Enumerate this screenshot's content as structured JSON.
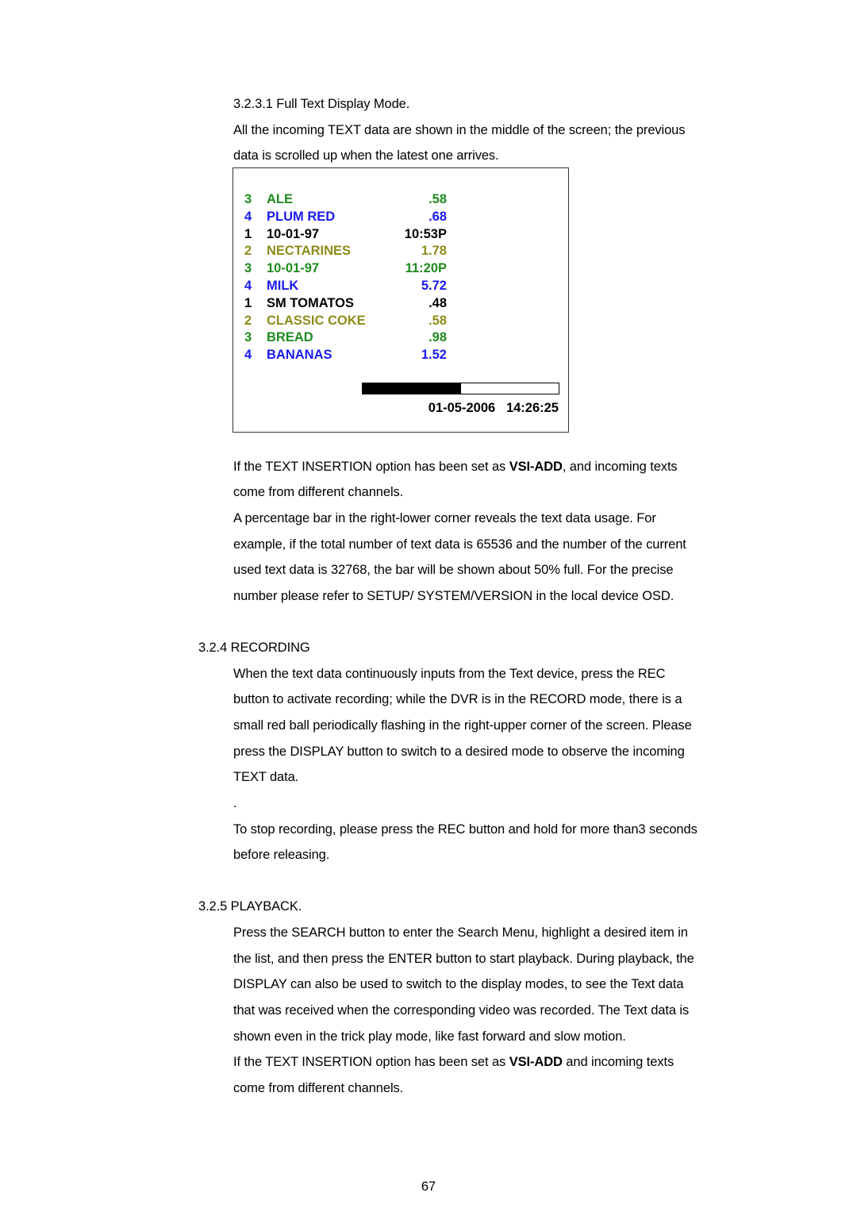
{
  "section_heading": "3.2.3.1 Full Text Display Mode.",
  "intro_lines": [
    "All the incoming TEXT data are shown in the middle of the screen; the previous",
    "data is scrolled up when the latest one arrives."
  ],
  "osd": {
    "rows": [
      {
        "channel": "3",
        "name": "ALE",
        "value": ".58",
        "color": "#1e8c1e"
      },
      {
        "channel": "4",
        "name": "PLUM RED",
        "value": ".68",
        "color": "#1a1aee"
      },
      {
        "channel": "1",
        "name": "10-01-97",
        "value": "10:53P",
        "color": "#000000"
      },
      {
        "channel": "2",
        "name": "NECTARINES",
        "value": "1.78",
        "color": "#8c8c1a"
      },
      {
        "channel": "3",
        "name": "10-01-97",
        "value": "11:20P",
        "color": "#1e8c1e"
      },
      {
        "channel": "4",
        "name": "MILK",
        "value": "5.72",
        "color": "#1a1aee"
      },
      {
        "channel": "1",
        "name": "SM TOMATOS",
        "value": ".48",
        "color": "#000000"
      },
      {
        "channel": "2",
        "name": "CLASSIC COKE",
        "value": ".58",
        "color": "#8c8c1a"
      },
      {
        "channel": "3",
        "name": "BREAD",
        "value": ".98",
        "color": "#1e8c1e"
      },
      {
        "channel": "4",
        "name": "BANANAS",
        "value": "1.52",
        "color": "#1a1aee"
      }
    ],
    "usage_percent": 50,
    "date": "01-05-2006",
    "time": "14:26:25"
  },
  "para1": {
    "l1_pre": "If the TEXT INSERTION option has been set as ",
    "l1_bold": "VSI-ADD",
    "l1_post": ", and incoming texts",
    "l2": "come from different channels."
  },
  "para2_lines": [
    "A percentage bar in the right-lower corner reveals the text data usage. For",
    "example, if the total number of text data is 65536 and the number of the current",
    "used text data is 32768, the bar will be shown about 50% full. For the precise",
    "number please refer to SETUP/ SYSTEM/VERSION in the local device OSD."
  ],
  "recording": {
    "heading": "3.2.4 RECORDING",
    "lines": [
      "When the text data continuously inputs from the Text device, press the REC",
      "button to activate recording; while the DVR is in the RECORD mode, there is a",
      "small red ball periodically flashing in the right-upper corner of the screen. Please",
      "press the DISPLAY button to switch to a desired mode to observe the incoming",
      "TEXT data."
    ],
    "dot": ".",
    "stop_lines": [
      "To stop recording, please press the REC button and hold for more than3 seconds",
      "before releasing."
    ]
  },
  "playback": {
    "heading": "3.2.5 PLAYBACK.",
    "lines": [
      "Press the SEARCH button to enter the Search Menu, highlight a desired item in",
      "the list, and then press the ENTER button to start playback. During playback, the",
      "DISPLAY can also be used to switch to the display modes, to see the Text data",
      "that was received when the corresponding video was recorded. The Text data is",
      "shown even in the trick play mode, like fast forward and slow motion."
    ],
    "l6_pre": "If the TEXT INSERTION option has been set as ",
    "l6_bold": "VSI-ADD",
    "l6_post": " and incoming texts",
    "l7": "come from different channels."
  },
  "page_number": "67"
}
